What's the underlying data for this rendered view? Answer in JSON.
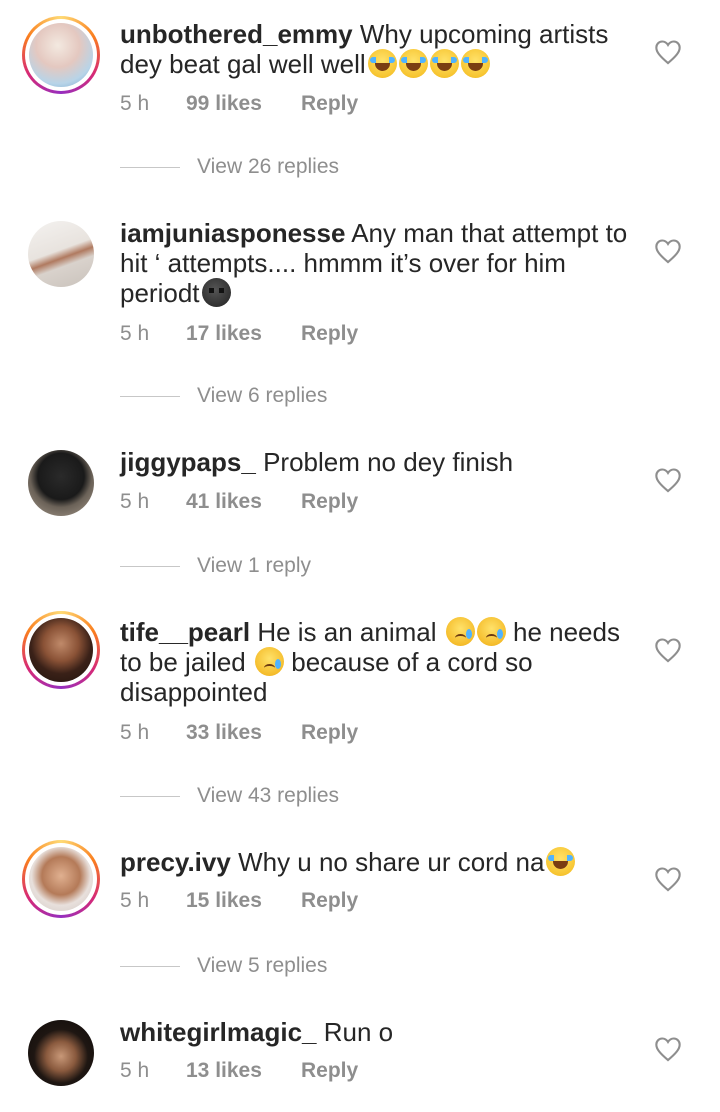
{
  "comments": [
    {
      "username": "unbothered_emmy",
      "text": "Why upcoming artists dey beat gal well well",
      "time": "5 h",
      "likes": "99 likes",
      "reply_label": "Reply",
      "view_replies": "View 26 replies",
      "has_story_ring": true
    },
    {
      "username": "iamjuniasponesse",
      "text": "Any man that attempt to hit ‘ attempts.... hmmm it’s over for him periodt",
      "time": "5 h",
      "likes": "17 likes",
      "reply_label": "Reply",
      "view_replies": "View 6 replies",
      "has_story_ring": false
    },
    {
      "username": "jiggypaps_",
      "text": "Problem no dey finish",
      "time": "5 h",
      "likes": "41 likes",
      "reply_label": "Reply",
      "view_replies": "View 1 reply",
      "has_story_ring": false
    },
    {
      "username": "tife__pearl",
      "text_part1": "He is an animal",
      "text_part2": "he needs to be jailed",
      "text_part3": "because of a cord so disappointed",
      "time": "5 h",
      "likes": "33 likes",
      "reply_label": "Reply",
      "view_replies": "View 43 replies",
      "has_story_ring": true
    },
    {
      "username": "precy.ivy",
      "text": "Why u no share ur cord na",
      "time": "5 h",
      "likes": "15 likes",
      "reply_label": "Reply",
      "view_replies": "View 5 replies",
      "has_story_ring": true
    },
    {
      "username": "whitegirlmagic_",
      "text": "Run o",
      "time": "5 h",
      "likes": "13 likes",
      "reply_label": "Reply",
      "has_story_ring": false
    }
  ],
  "icons": {
    "like": "heart-outline-icon",
    "laugh_emoji": "face-with-tears-of-joy",
    "sad_emoji": "crying-face",
    "dark_emoji": "new-moon-face"
  },
  "colors": {
    "text": "#262626",
    "secondary": "#8e8e8e",
    "divider": "#c7c7c7"
  }
}
